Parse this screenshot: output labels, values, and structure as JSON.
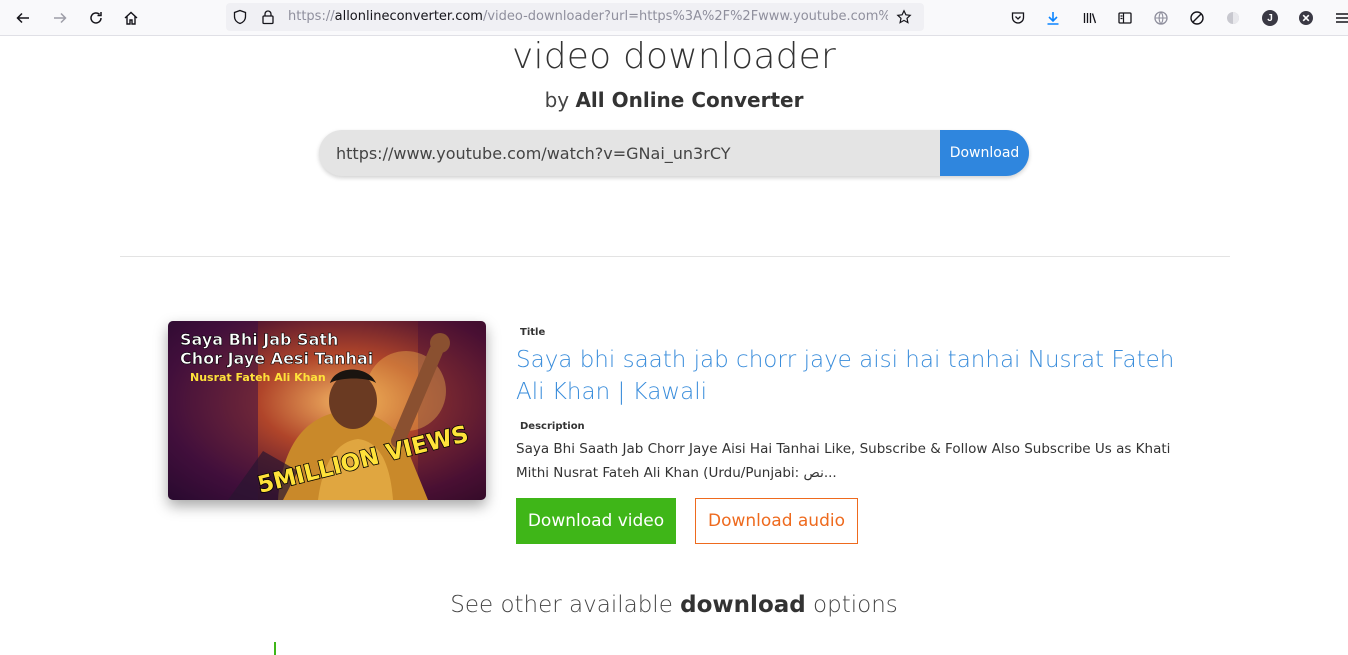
{
  "browser": {
    "url_scheme": "https://",
    "url_host": "allonlineconverter.com",
    "url_path": "/video-downloader?url=https%3A%2F%2Fwww.youtube.com%2Fwatch",
    "profile_initial": "J"
  },
  "hero": {
    "title": "video downloader",
    "by": "by",
    "brand": "All Online Converter"
  },
  "search": {
    "value": "https://www.youtube.com/watch?v=GNai_un3rCY",
    "button": "Download"
  },
  "result": {
    "thumbnail": {
      "line1": "Saya Bhi Jab Sath",
      "line2": "Chor Jaye Aesi Tanhai",
      "line3": "Nusrat Fateh Ali Khan",
      "badge": "5MILLION VIEWS"
    },
    "title_label": "Title",
    "title": "Saya bhi saath jab chorr jaye aisi hai tanhai Nusrat Fateh Ali Khan | Kawali",
    "description_label": "Description",
    "description": "Saya Bhi Saath Jab Chorr Jaye Aisi Hai Tanhai Like, Subscribe & Follow Also Subscribe Us as Khati Mithi Nusrat Fateh Ali Khan (Urdu/Punjabi: نص...",
    "download_video": "Download video",
    "download_audio": "Download audio"
  },
  "other": {
    "prefix": "See other available",
    "bold": "download",
    "suffix": "options"
  },
  "colors": {
    "accent_blue": "#2f86de",
    "title_blue": "#3a8ddb",
    "green": "#3fb618",
    "orange": "#ee6a1e"
  }
}
